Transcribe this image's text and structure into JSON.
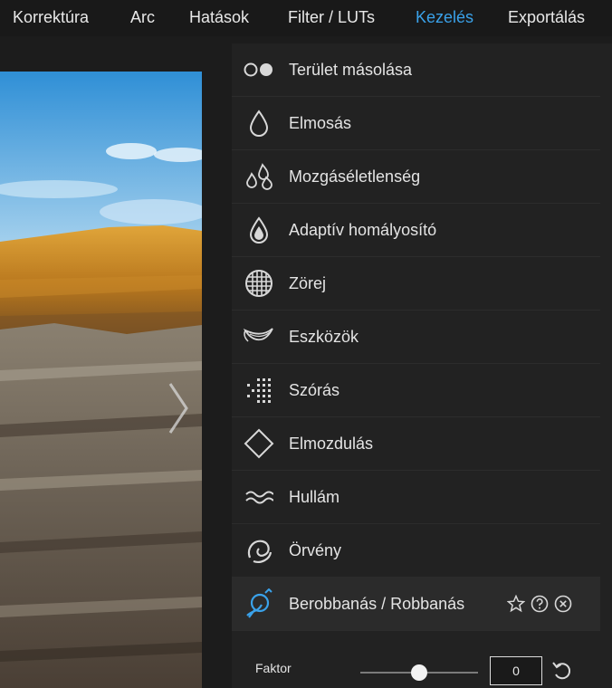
{
  "menu": {
    "tabs": [
      {
        "label": "Korrektúra",
        "active": false
      },
      {
        "label": "Arc",
        "active": false
      },
      {
        "label": "Hatások",
        "active": false
      },
      {
        "label": "Filter / LUTs",
        "active": false
      },
      {
        "label": "Kezelés",
        "active": true
      },
      {
        "label": "Exportálás",
        "active": false
      }
    ]
  },
  "colors": {
    "accent": "#3aa2ea",
    "panel_bg": "#222222",
    "selected_bg": "#2b2b2b"
  },
  "tools": {
    "items": [
      {
        "label": "Terület másolása",
        "icon": "clone-circles-icon"
      },
      {
        "label": "Elmosás",
        "icon": "drop-icon"
      },
      {
        "label": "Mozgáséletlenség",
        "icon": "multi-drop-icon"
      },
      {
        "label": "Adaptív homályosító",
        "icon": "filled-drop-icon"
      },
      {
        "label": "Zörej",
        "icon": "noise-grid-icon"
      },
      {
        "label": "Eszközök",
        "icon": "leaf-icon"
      },
      {
        "label": "Szórás",
        "icon": "scatter-dots-icon"
      },
      {
        "label": "Elmozdulás",
        "icon": "diamond-icon"
      },
      {
        "label": "Hullám",
        "icon": "wave-icon"
      },
      {
        "label": "Örvény",
        "icon": "swirl-icon"
      },
      {
        "label": "Berobbanás / Robbanás",
        "icon": "pinch-icon",
        "selected": true
      }
    ]
  },
  "factor": {
    "label": "Faktor",
    "value": "0",
    "slider_fraction": 0.5
  }
}
